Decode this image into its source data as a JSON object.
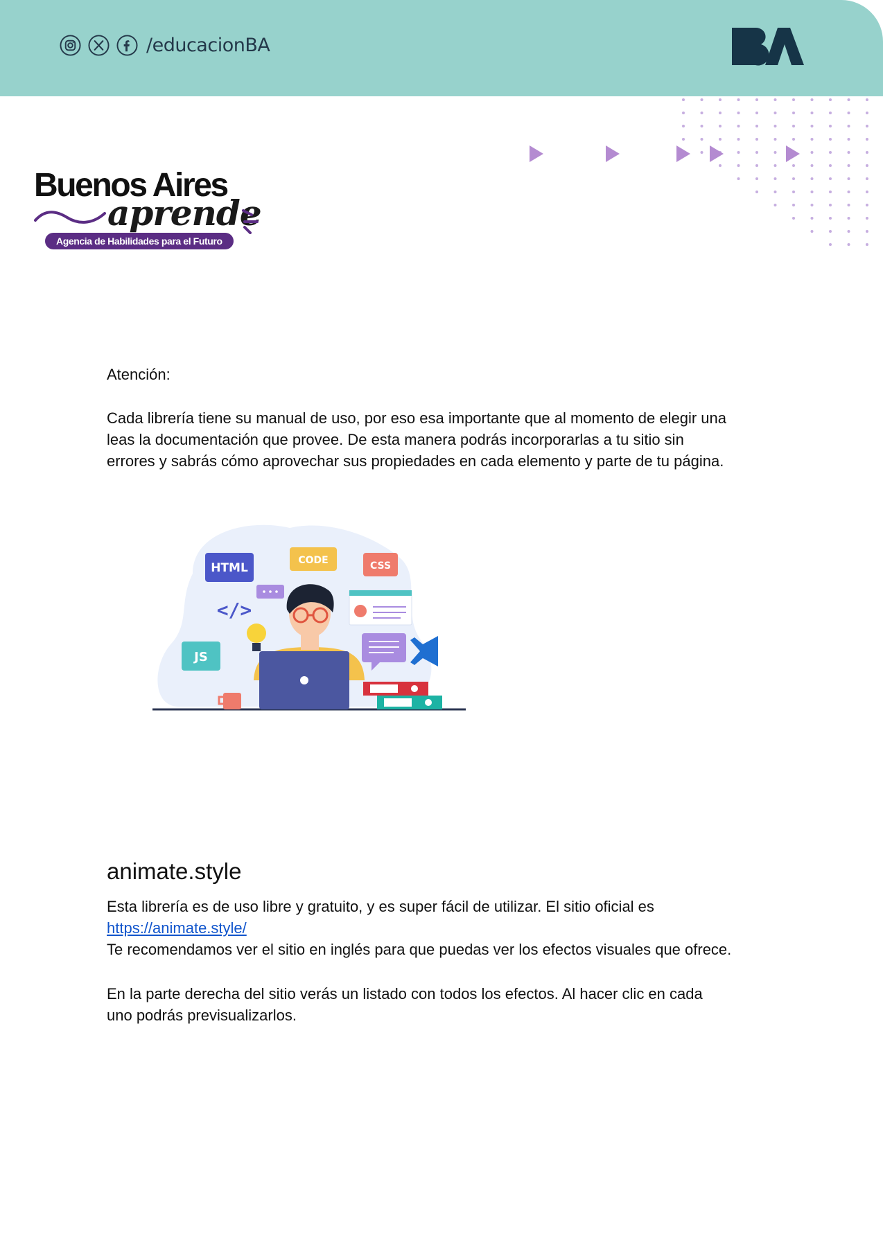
{
  "header": {
    "social_handle": "/educacionBA",
    "social_icons": [
      "instagram-icon",
      "x-icon",
      "facebook-icon"
    ],
    "logo": "BA",
    "colors": {
      "band": "#97d2cc",
      "logo": "#163447"
    }
  },
  "brand": {
    "title": "Buenos Aires",
    "script": "aprende",
    "tagline": "Agencia de Habilidades para el Futuro",
    "colors": {
      "accent": "#5b2d84"
    }
  },
  "content": {
    "attention_label": "Atención:",
    "paragraph1_lines": [
      "Cada librería tiene su manual de uso, por eso esa importante que al momento de elegir una",
      "leas la documentación que provee. De esta manera podrás incorporarlas a tu sitio  sin",
      "errores y sabrás cómo aprovechar sus propiedades en cada elemento y parte de tu página."
    ],
    "illustration": {
      "tag_html": "HTML",
      "tag_code": "CODE",
      "tag_css": "CSS",
      "tag_js": "JS",
      "code_symbol": "</>"
    },
    "section_heading": "animate.style",
    "paragraph2_line1": "Esta librería es de uso libre y gratuito, y es super fácil de utilizar. El sitio oficial es",
    "link_text": "https://animate.style/",
    "paragraph2_line3": "Te recomendamos ver el sitio en inglés para que puedas ver los efectos visuales que ofrece.",
    "paragraph3_lines": [
      "En la parte derecha del sitio verás un listado con todos los efectos. Al hacer clic en cada",
      "uno podrás previsualizarlos."
    ],
    "link_color": "#1155cc"
  }
}
